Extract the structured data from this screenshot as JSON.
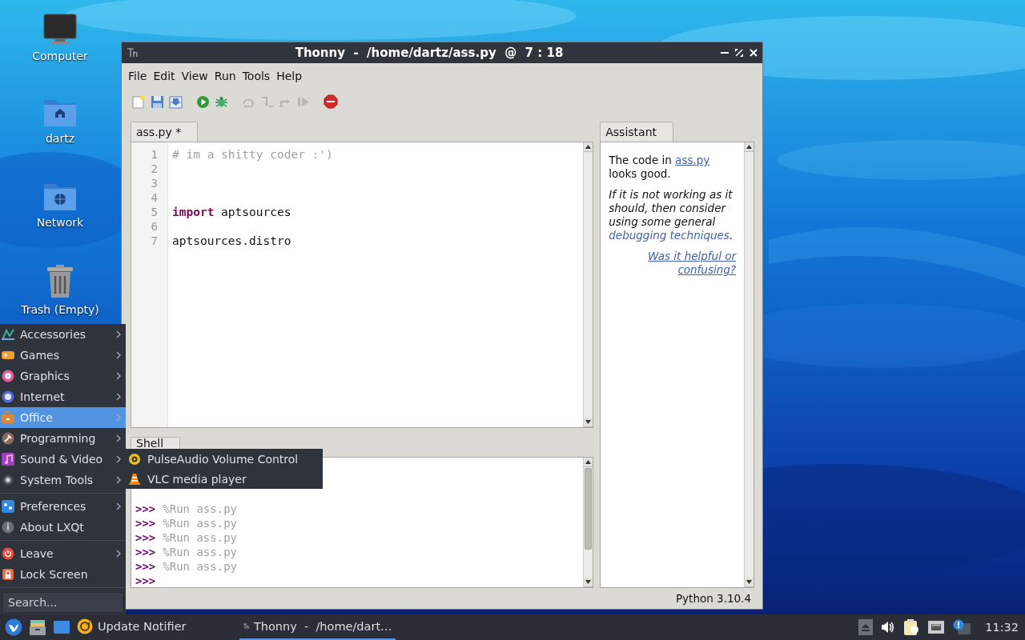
{
  "desktop_icons": [
    {
      "kind": "computer",
      "label": "Computer"
    },
    {
      "kind": "home",
      "label": "dartz"
    },
    {
      "kind": "network",
      "label": "Network"
    },
    {
      "kind": "trash",
      "label": "Trash (Empty)"
    }
  ],
  "window": {
    "title": "Thonny  -  /home/dartz/ass.py  @  7 : 18",
    "menu": [
      "File",
      "Edit",
      "View",
      "Run",
      "Tools",
      "Help"
    ],
    "toolbar": [
      {
        "buttons": [
          {
            "kind": "new",
            "disabled": false
          },
          {
            "kind": "open",
            "disabled": false
          },
          {
            "kind": "save",
            "disabled": false
          }
        ]
      },
      {
        "buttons": [
          {
            "kind": "run",
            "disabled": false
          },
          {
            "kind": "debug",
            "disabled": false
          }
        ]
      },
      {
        "buttons": [
          {
            "kind": "step-over",
            "disabled": true
          },
          {
            "kind": "step-into",
            "disabled": true
          },
          {
            "kind": "step-out",
            "disabled": true
          },
          {
            "kind": "resume",
            "disabled": true
          }
        ]
      },
      {
        "buttons": [
          {
            "kind": "stop",
            "disabled": false
          }
        ]
      }
    ],
    "editor": {
      "tab": "ass.py *",
      "lines": [
        {
          "number": "1",
          "tokens": [
            {
              "kind": "comment",
              "text": "# im a shitty coder :')"
            }
          ]
        },
        {
          "number": "2"
        },
        {
          "number": "3"
        },
        {
          "number": "4"
        },
        {
          "number": "5",
          "tokens": [
            {
              "kind": "keyword",
              "text": "import"
            },
            {
              "kind": "plain",
              "text": " aptsources"
            }
          ]
        },
        {
          "number": "6"
        },
        {
          "number": "7",
          "tokens": [
            {
              "kind": "plain",
              "text": "aptsources.distro"
            }
          ]
        }
      ]
    },
    "shell": {
      "tab": "Shell",
      "lines": [
        {
          "prompt": ">>>",
          "command": "%Run ass.py"
        },
        {
          "prompt": ">>>",
          "command": "%Run ass.py"
        },
        {
          "prompt": ">>>",
          "command": "%Run ass.py"
        },
        {
          "prompt": ">>>",
          "command": "%Run ass.py"
        },
        {
          "prompt": ">>>",
          "command": "%Run ass.py"
        },
        {
          "prompt": ">>>"
        }
      ]
    },
    "assistant": {
      "tab": "Assistant",
      "message": {
        "before": "The code in",
        "link": "ass.py",
        "after": "looks good."
      },
      "advice": {
        "before": "If it is not working as it should, then consider using some general",
        "link": "debugging techniques",
        "after": "."
      },
      "feedback": "Was it helpful or confusing?"
    },
    "status_bar": "Python 3.10.4"
  },
  "start_menu": {
    "groups": [
      {
        "items": [
          {
            "kind": "accessories",
            "label": "Accessories",
            "submenu": true,
            "selected": false
          },
          {
            "kind": "games",
            "label": "Games",
            "submenu": true,
            "selected": false
          },
          {
            "kind": "graphics",
            "label": "Graphics",
            "submenu": true,
            "selected": false
          },
          {
            "kind": "internet",
            "label": "Internet",
            "submenu": true,
            "selected": false
          },
          {
            "kind": "office",
            "label": "Office",
            "submenu": true,
            "selected": true
          },
          {
            "kind": "programming",
            "label": "Programming",
            "submenu": true,
            "selected": false
          },
          {
            "kind": "sound",
            "label": "Sound & Video",
            "submenu": true,
            "selected": false
          },
          {
            "kind": "system",
            "label": "System Tools",
            "submenu": true,
            "selected": false
          }
        ]
      },
      {
        "items": [
          {
            "kind": "preferences",
            "label": "Preferences",
            "submenu": true,
            "selected": false
          },
          {
            "kind": "about",
            "label": "About LXQt",
            "submenu": false,
            "selected": false
          }
        ]
      },
      {
        "items": [
          {
            "kind": "leave",
            "label": "Leave",
            "submenu": true,
            "selected": false
          },
          {
            "kind": "lock",
            "label": "Lock Screen",
            "submenu": false,
            "selected": false
          }
        ]
      }
    ],
    "search": {
      "placeholder": "Search..."
    }
  },
  "submenu": {
    "items": [
      {
        "kind": "volume",
        "label": "PulseAudio Volume Control"
      },
      {
        "kind": "vlc",
        "label": "VLC media player"
      }
    ]
  },
  "taskbar": {
    "launchers": [
      {
        "kind": "start"
      },
      {
        "kind": "files"
      },
      {
        "kind": "desktop"
      }
    ],
    "tasks": [
      {
        "kind": "update",
        "label": "Update Notifier",
        "selected": false
      },
      {
        "kind": "thonny",
        "label": "Thonny  -  /home/dart…",
        "selected": true
      }
    ],
    "tray": [
      {
        "kind": "eject"
      },
      {
        "kind": "volume"
      },
      {
        "kind": "clipboard"
      },
      {
        "kind": "network"
      },
      {
        "kind": "notification"
      }
    ],
    "clock": "11:32"
  }
}
